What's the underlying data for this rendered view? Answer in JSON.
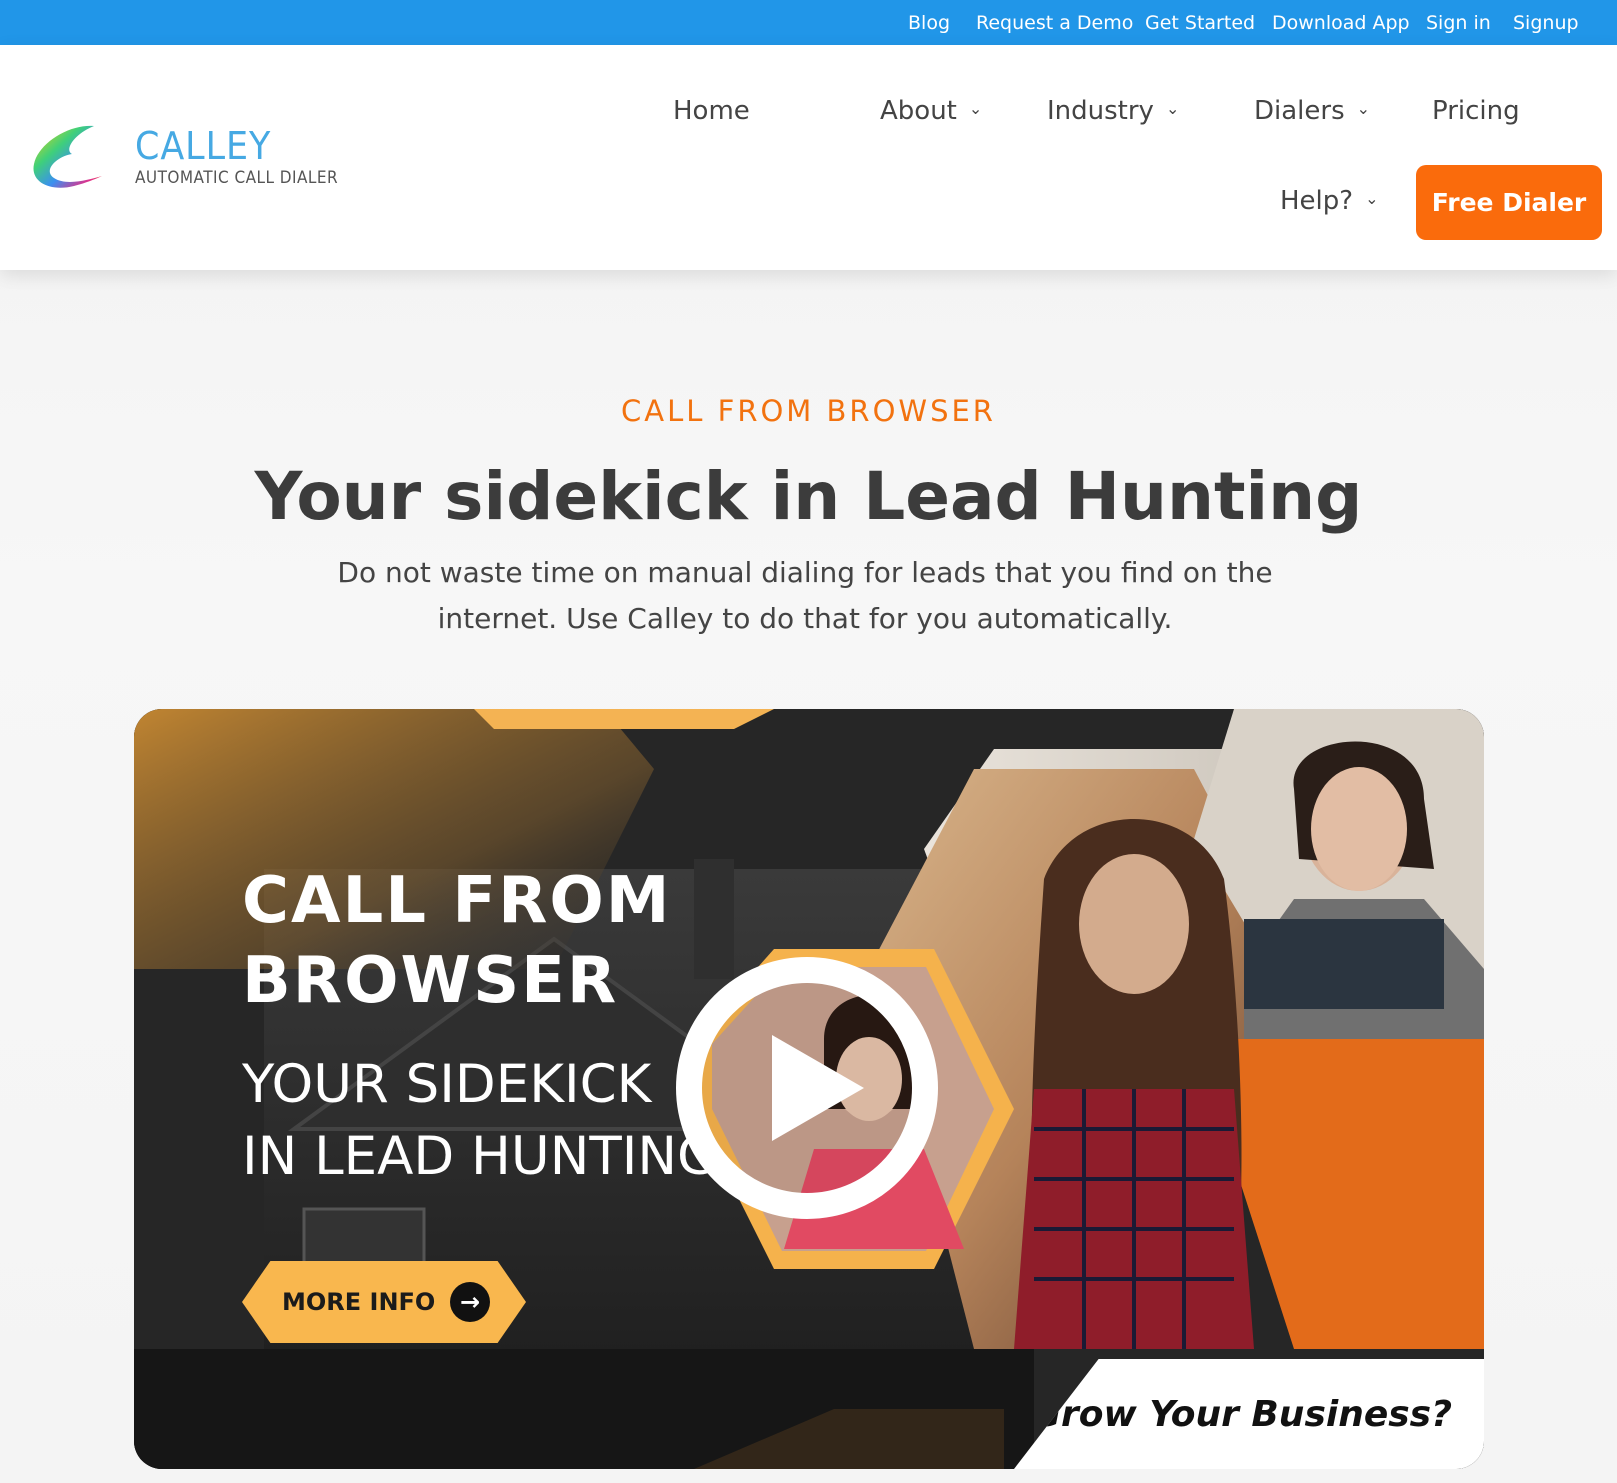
{
  "topbar": {
    "links": [
      "Blog",
      "Request a Demo",
      "Get Started",
      "Download App",
      "Sign in",
      "Signup"
    ]
  },
  "logo": {
    "name": "CALLEY",
    "tagline": "AUTOMATIC CALL DIALER"
  },
  "nav": {
    "home": "Home",
    "about": "About",
    "industry": "Industry",
    "dialers": "Dialers",
    "pricing": "Pricing",
    "help": "Help?",
    "cta": "Free Dialer"
  },
  "hero": {
    "eyebrow": "CALL FROM BROWSER",
    "headline_light": "Your sidekick in ",
    "headline_bold": "Lead Hunting",
    "subtext": "Do not waste time on manual dialing for leads that you find on the internet. Use Calley to do that for you automatically."
  },
  "video": {
    "title": "CALL FROM\nBROWSER",
    "subtitle": "YOUR SIDEKICK\nIN LEAD HUNTING",
    "button": "MORE INFO",
    "tagline": "Grow Your Business?"
  },
  "colors": {
    "topbar": "#2196e8",
    "accent": "#fa6b0c",
    "gold": "#f9b74e",
    "logo": "#46a9e3"
  },
  "icons": {
    "chevron": "chevron-down-icon",
    "play": "play-icon",
    "arrow": "arrow-right-icon"
  }
}
